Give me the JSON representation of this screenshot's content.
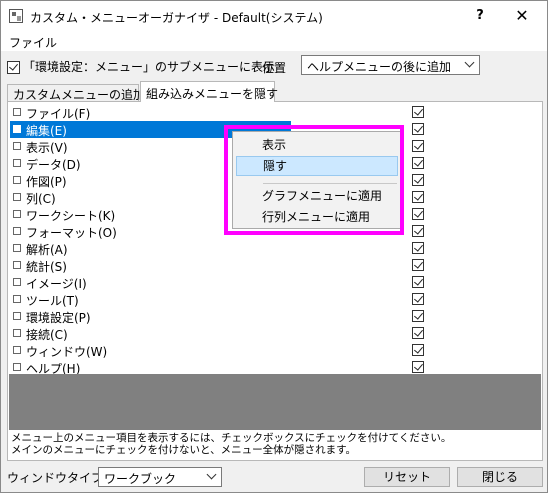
{
  "window": {
    "title": "カスタム・メニューオーガナイザ - Default(システム)",
    "help_label": "?",
    "close_label": "✕"
  },
  "menubar": {
    "file": "ファイル"
  },
  "options": {
    "show_submenu_label": "「環境設定：メニュー」のサブメニューに表示",
    "show_submenu_checked": true,
    "position_label": "位置",
    "position_value": "ヘルプメニューの後に追加"
  },
  "tabs": [
    {
      "label": "カスタムメニューの追加",
      "active": false
    },
    {
      "label": "組み込みメニューを隠す",
      "active": true
    }
  ],
  "menu_items": [
    {
      "label": "ファイル(F)",
      "checked": true,
      "selected": false
    },
    {
      "label": "編集(E)",
      "checked": true,
      "selected": true
    },
    {
      "label": "表示(V)",
      "checked": true,
      "selected": false
    },
    {
      "label": "データ(D)",
      "checked": true,
      "selected": false
    },
    {
      "label": "作図(P)",
      "checked": true,
      "selected": false
    },
    {
      "label": "列(C)",
      "checked": true,
      "selected": false
    },
    {
      "label": "ワークシート(K)",
      "checked": true,
      "selected": false
    },
    {
      "label": "フォーマット(O)",
      "checked": true,
      "selected": false
    },
    {
      "label": "解析(A)",
      "checked": true,
      "selected": false
    },
    {
      "label": "統計(S)",
      "checked": true,
      "selected": false
    },
    {
      "label": "イメージ(I)",
      "checked": true,
      "selected": false
    },
    {
      "label": "ツール(T)",
      "checked": true,
      "selected": false
    },
    {
      "label": "環境設定(P)",
      "checked": true,
      "selected": false
    },
    {
      "label": "接続(C)",
      "checked": true,
      "selected": false
    },
    {
      "label": "ウィンドウ(W)",
      "checked": true,
      "selected": false
    },
    {
      "label": "ヘルプ(H)",
      "checked": true,
      "selected": false
    }
  ],
  "info": {
    "line1": "メニュー上のメニュー項目を表示するには、チェックボックスにチェックを付けてください。",
    "line2": "メインのメニューにチェックを付けないと、メニュー全体が隠されます。"
  },
  "bottom": {
    "window_type_label": "ウィンドウタイプ",
    "window_type_value": "ワークブック",
    "reset_label": "リセット",
    "close_label": "閉じる"
  },
  "context_menu": {
    "items": [
      {
        "label": "表示",
        "hover": false
      },
      {
        "label": "隠す",
        "hover": true
      },
      {
        "label": "グラフメニューに適用",
        "hover": false
      },
      {
        "label": "行列メニューに適用",
        "hover": false
      }
    ]
  },
  "colors": {
    "selection": "#0078d7",
    "highlight_frame": "#ff00ff",
    "context_hover": "#cce8ff",
    "empty_area": "#808080"
  }
}
